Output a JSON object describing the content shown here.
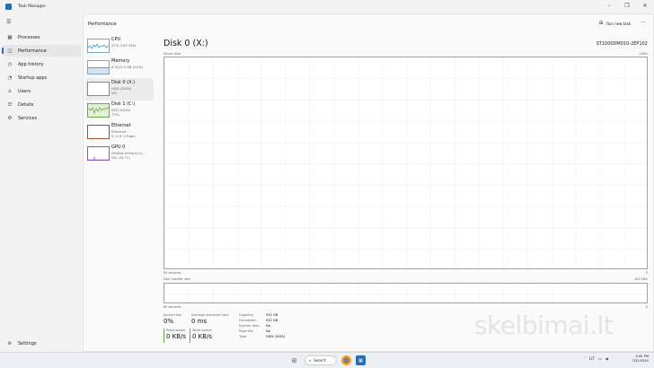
{
  "app": {
    "title": "Task Manager"
  },
  "nav": {
    "items": [
      {
        "label": "Processes",
        "icon": "processes-icon",
        "glyph": "▦"
      },
      {
        "label": "Performance",
        "icon": "performance-icon",
        "glyph": "◫",
        "selected": true
      },
      {
        "label": "App history",
        "icon": "history-icon",
        "glyph": "◷"
      },
      {
        "label": "Startup apps",
        "icon": "startup-icon",
        "glyph": "◔"
      },
      {
        "label": "Users",
        "icon": "users-icon",
        "glyph": "♙"
      },
      {
        "label": "Details",
        "icon": "details-icon",
        "glyph": "☰"
      },
      {
        "label": "Services",
        "icon": "services-icon",
        "glyph": "⚙"
      }
    ],
    "settings": "Settings"
  },
  "header": {
    "title": "Performance",
    "run_task": "Run new task",
    "more": "···"
  },
  "devices": [
    {
      "name": "CPU",
      "line1": "27%  3.87 GHz",
      "line2": ""
    },
    {
      "name": "Memory",
      "line1": "8.3/15.9 GB (52%)",
      "line2": ""
    },
    {
      "name": "Disk 0 (X:)",
      "line1": "HDD (SATA)",
      "line2": "0%",
      "selected": true
    },
    {
      "name": "Disk 1 (C:)",
      "line1": "SSD (SATA)",
      "line2": "73%"
    },
    {
      "name": "Ethernet",
      "line1": "Ethernet",
      "line2": "S: 0 R: 0 Kbps"
    },
    {
      "name": "GPU 0",
      "line1": "NVIDIA GeForce G...",
      "line2": "0% (44 °C)"
    }
  ],
  "main": {
    "disk_title": "Disk 0 (X:)",
    "model": "ST1000DM010-2EP102",
    "active_time_label": "Active time",
    "active_max": "100%",
    "seconds_label": "60 seconds",
    "zero": "0",
    "transfer_label": "Disk transfer rate",
    "transfer_max": "100 KB/s",
    "active_time_value": "0%",
    "avg_response_label": "Average response time",
    "avg_response_value": "0 ms",
    "read_label": "Read speed",
    "read_value": "0 KB/s",
    "write_label": "Write speed",
    "write_value": "0 KB/s",
    "props": [
      {
        "k": "Capacity:",
        "v": "932 GB"
      },
      {
        "k": "Formatted:",
        "v": "932 GB"
      },
      {
        "k": "System disk:",
        "v": "No"
      },
      {
        "k": "Page file:",
        "v": "No"
      },
      {
        "k": "Type:",
        "v": "HDD (SATA)"
      }
    ]
  },
  "watermark": "skelbimai.lt",
  "taskbar": {
    "search": "Search",
    "lang": "LIT",
    "time": "4:44 PM",
    "date": "7/31/2025"
  }
}
